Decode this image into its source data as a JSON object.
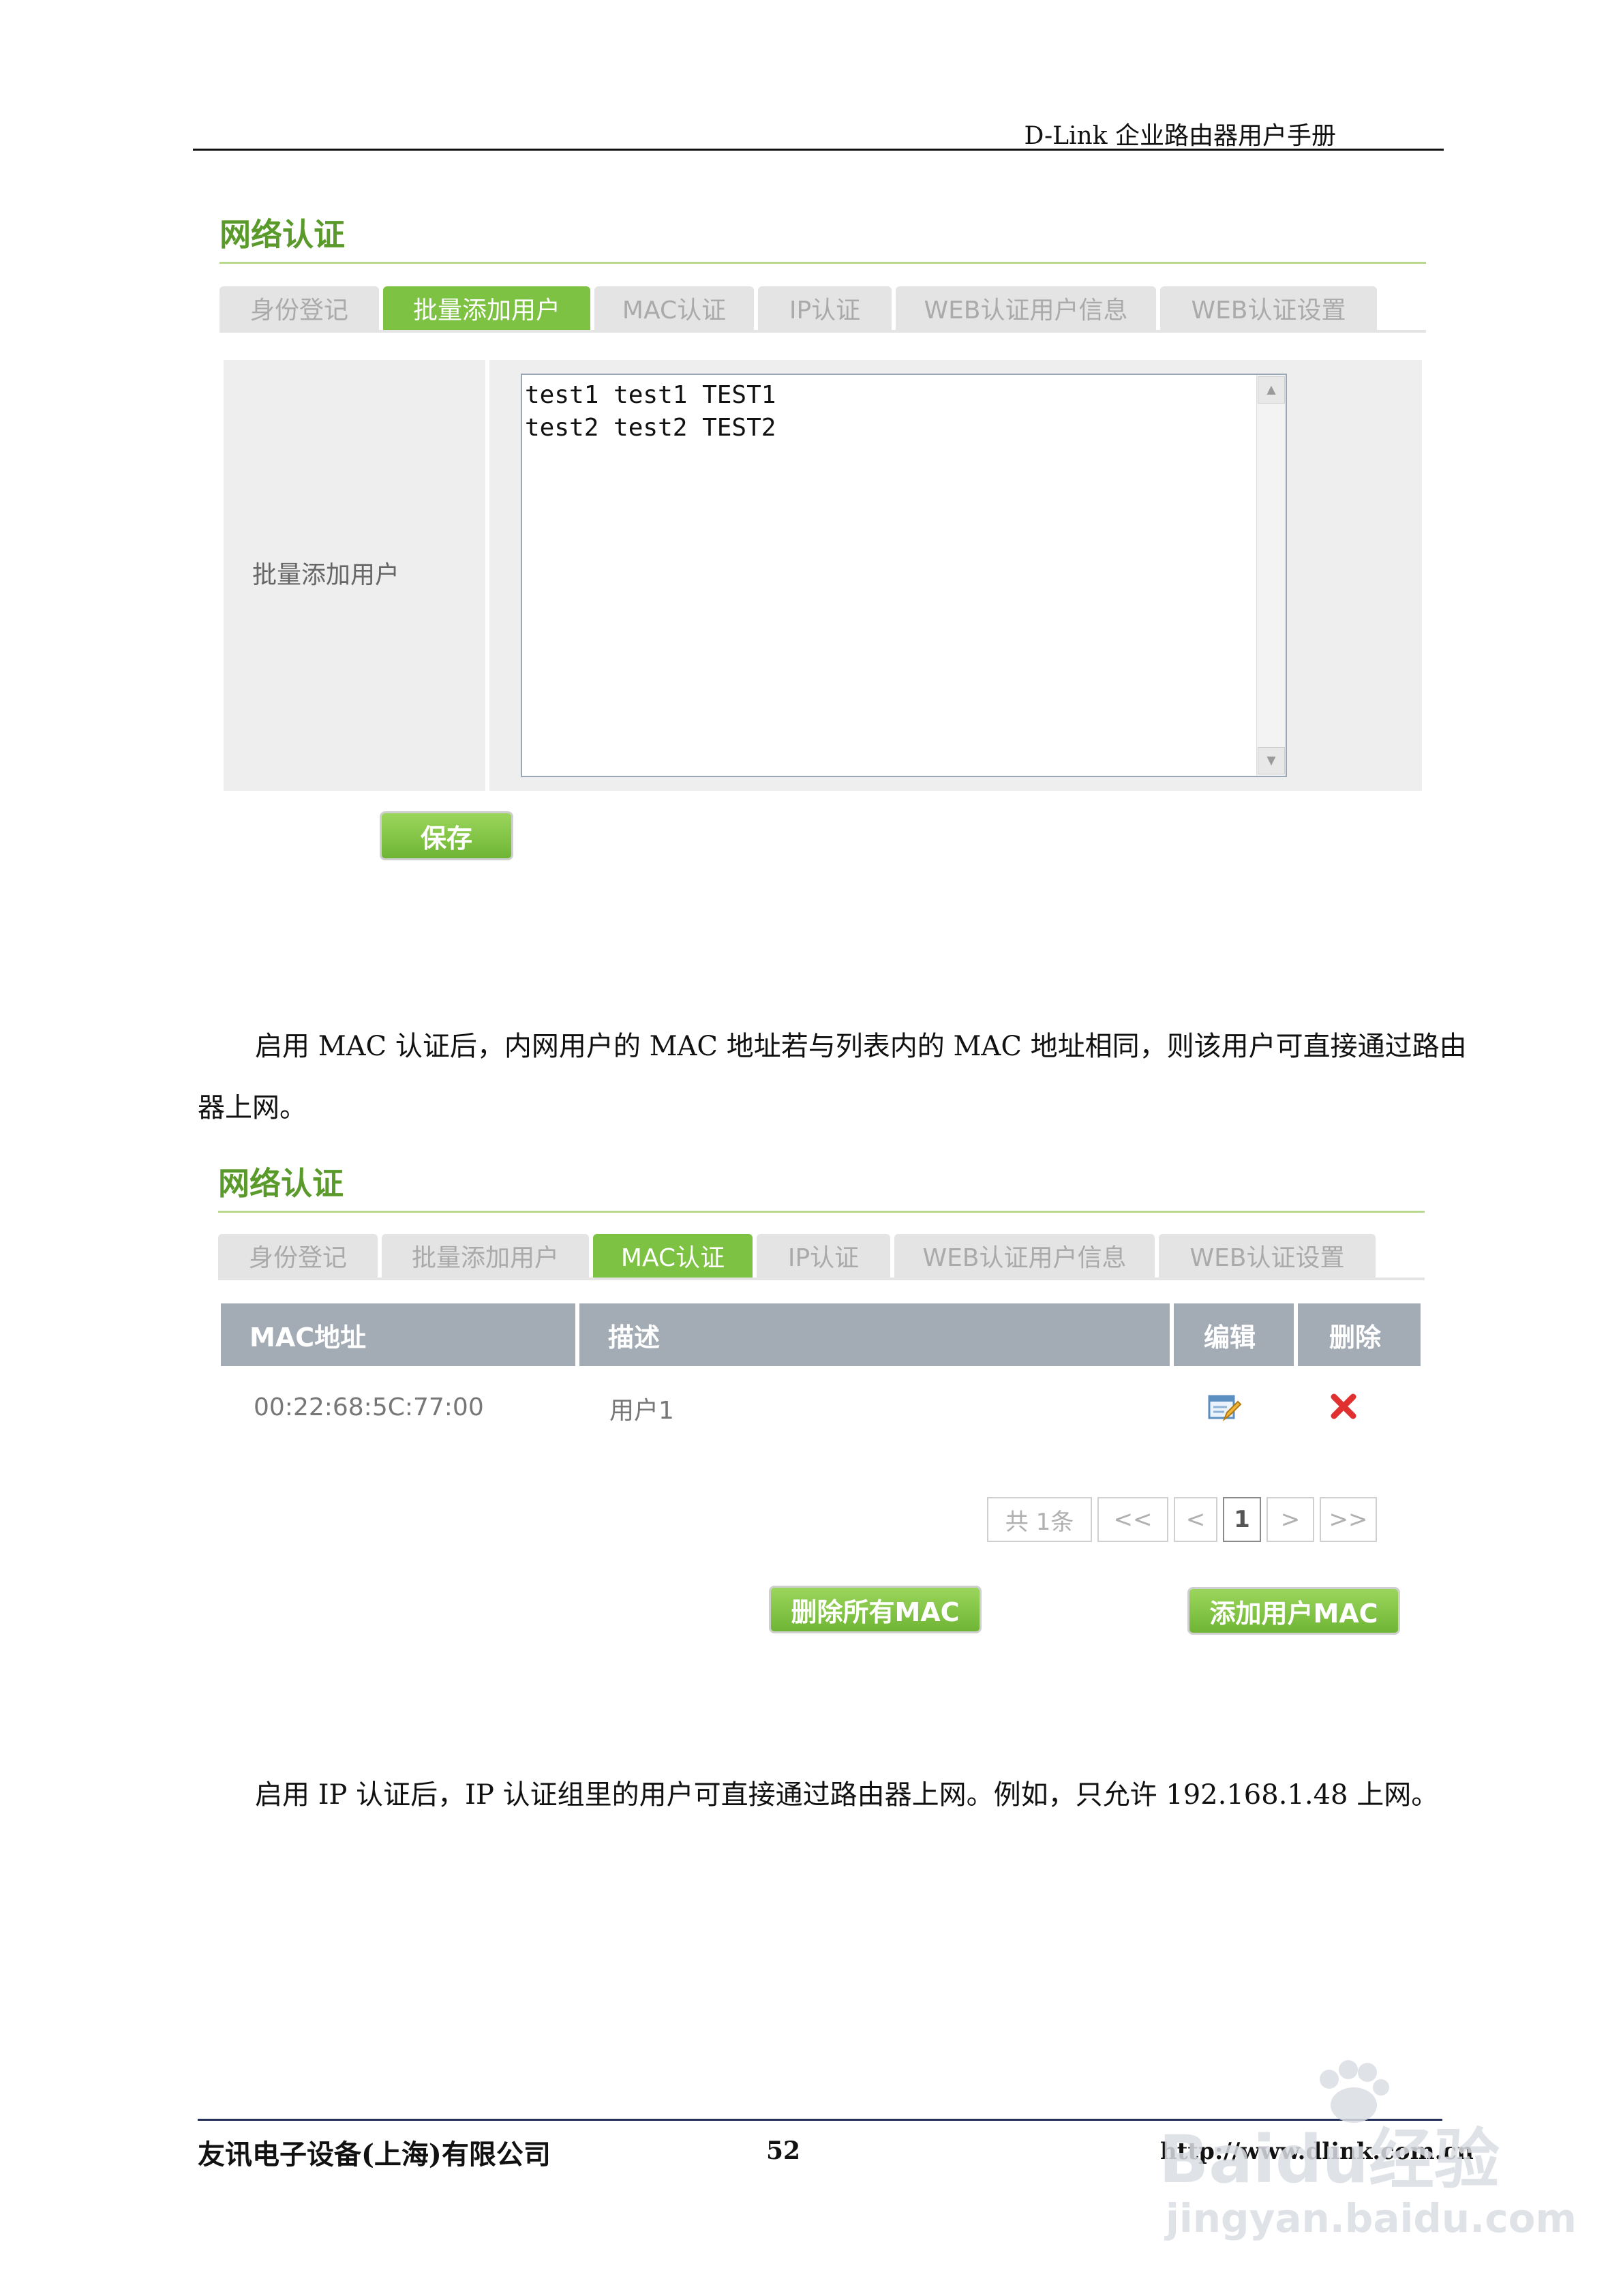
{
  "header": {
    "title": "D-Link 企业路由器用户手册"
  },
  "panel1": {
    "title": "网络认证",
    "tabs": [
      "身份登记",
      "批量添加用户",
      "MAC认证",
      "IP认证",
      "WEB认证用户信息",
      "WEB认证设置"
    ],
    "active_tab": 1,
    "label": "批量添加用户",
    "textarea_lines": [
      "test1 test1 TEST1",
      "test2 test2 TEST2"
    ],
    "save_label": "保存"
  },
  "paragraph1": {
    "line1": "启用 MAC 认证后，内网用户的 MAC 地址若与列表内的 MAC 地址相同，则该用户可直接通过路由",
    "line2": "器上网。"
  },
  "panel2": {
    "title": "网络认证",
    "tabs": [
      "身份登记",
      "批量添加用户",
      "MAC认证",
      "IP认证",
      "WEB认证用户信息",
      "WEB认证设置"
    ],
    "active_tab": 2,
    "table": {
      "headers": [
        "MAC地址",
        "描述",
        "编辑",
        "删除"
      ],
      "rows": [
        {
          "mac": "00:22:68:5C:77:00",
          "desc": "用户1"
        }
      ]
    },
    "pager": {
      "total": "共 1条",
      "first": "<<",
      "prev": "<",
      "page": "1",
      "next": ">",
      "last": ">>"
    },
    "delete_all_label": "删除所有MAC",
    "add_label": "添加用户MAC"
  },
  "paragraph2": "启用 IP 认证后，IP 认证组里的用户可直接通过路由器上网。例如，只允许 192.168.1.48 上网。",
  "footer": {
    "company": "友讯电子设备(上海)有限公司",
    "page": "52",
    "url": "http://www.dlink.com.cn"
  },
  "watermark": {
    "brand": "Baidu经验",
    "url": "jingyan.baidu.com"
  },
  "colors": {
    "accent_green": "#7dc242",
    "title_green": "#5a9a2a",
    "table_header": "#a3abb5",
    "delete_red": "#e03030"
  }
}
